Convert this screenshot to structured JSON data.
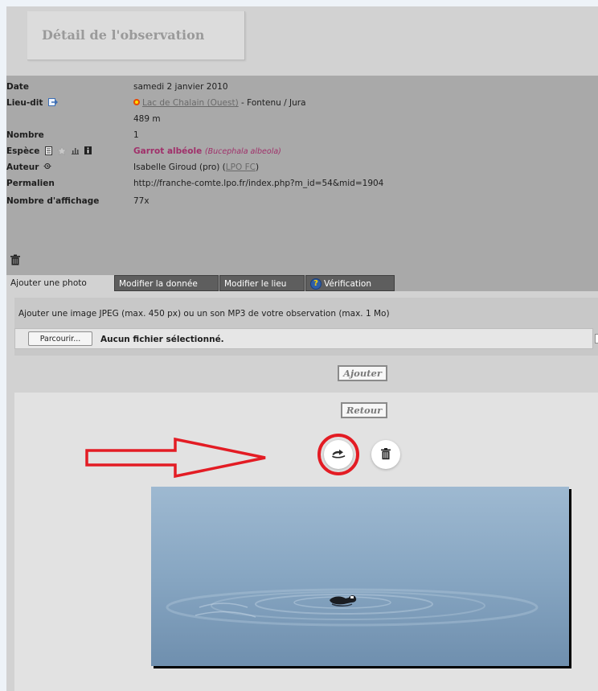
{
  "page_title": "Détail de l'observation",
  "observation": {
    "date_label": "Date",
    "date_value": "samedi 2 janvier 2010",
    "lieu_label": "Lieu-dit",
    "lieu_link": "Lac de Chalain (Ouest)",
    "lieu_rest": " - Fontenu / Jura",
    "altitude": "489 m",
    "nombre_label": "Nombre",
    "nombre_value": "1",
    "espece_label": "Espèce",
    "espece_name": "Garrot albéole",
    "espece_latin": "(Bucephala albeola)",
    "auteur_label": "Auteur",
    "auteur_name": "Isabelle Giroud (pro) (",
    "auteur_link": "LPO FC",
    "auteur_close": ")",
    "permalien_label": "Permalien",
    "permalien_value": "http://franche-comte.lpo.fr/index.php?m_id=54&mid=1904",
    "affichage_label": "Nombre d'affichage",
    "affichage_value": "77x"
  },
  "tabs": {
    "ajouter_photo": "Ajouter une photo",
    "modifier_donnee": "Modifier la donnée",
    "modifier_lieu": "Modifier le lieu",
    "verification": "Vérification"
  },
  "upload": {
    "instructions": "Ajouter une image JPEG (max. 450 px) ou un son MP3 de votre observation (max. 1 Mo)",
    "browse_label": "Parcourir...",
    "file_status": "Aucun fichier sélectionné.",
    "submit_label": "Ajouter"
  },
  "photo_panel": {
    "back_label": "Retour"
  },
  "colors": {
    "species": "#a0306a",
    "highlight": "#e31c24",
    "header_bg": "#a9a9a9"
  },
  "icons": [
    "location-dot-icon",
    "map-export-icon",
    "list-icon",
    "star-icon",
    "chart-icon",
    "info-icon",
    "author-icon",
    "trash-icon",
    "help-icon",
    "rotate-icon"
  ]
}
